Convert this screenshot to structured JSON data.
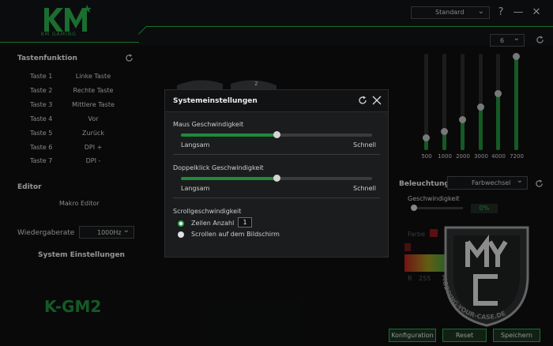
{
  "header": {
    "logo_text": "KM GAMING",
    "profile": "Standard",
    "help_symbol": "?",
    "minimize_symbol": "—",
    "close_symbol": "✕",
    "dropdown_arrow": "⌄"
  },
  "left": {
    "tastenfunktion_title": "Tastenfunktion",
    "keys": [
      {
        "label": "Taste 1",
        "func": "Linke Taste"
      },
      {
        "label": "Taste 2",
        "func": "Rechte Taste"
      },
      {
        "label": "Taste 3",
        "func": "Mittlere Taste"
      },
      {
        "label": "Taste 4",
        "func": "Vor"
      },
      {
        "label": "Taste 5",
        "func": "Zurück"
      },
      {
        "label": "Taste 6",
        "func": "DPI +"
      },
      {
        "label": "Taste 7",
        "func": "DPI -"
      }
    ],
    "editor_title": "Editor",
    "makro_editor": "Makro Editor",
    "wiedergaberate_label": "Wiedergaberate",
    "wiedergaberate_value": "1000Hz",
    "system_einstellungen": "System Einstellungen",
    "model_name": "K-GM2"
  },
  "mouse_badge": "2",
  "dpi": {
    "profile_value": "6",
    "levels": [
      {
        "value": "500",
        "level": 0.12
      },
      {
        "value": "1000",
        "level": 0.19
      },
      {
        "value": "2000",
        "level": 0.31
      },
      {
        "value": "3000",
        "level": 0.44
      },
      {
        "value": "4000",
        "level": 0.58
      },
      {
        "value": "7200",
        "level": 0.97
      }
    ]
  },
  "lighting": {
    "title": "Beleuchtung",
    "mode": "Farbwechsel",
    "speed_label": "Geschwindigkeit",
    "speed_value": "0%",
    "speed_level": 0.0,
    "color_label": "Farbe",
    "r_label": "R",
    "r_value": "255"
  },
  "buttons": {
    "konfiguration": "Konfiguration",
    "reset": "Reset",
    "speichern": "Speichern"
  },
  "dialog": {
    "title": "Systemeinstellungen",
    "maus_title": "Maus Geschwindigkeit",
    "maus_level": 0.5,
    "maus_min": "Langsam",
    "maus_max": "Schnell",
    "doppel_title": "Doppelklick Geschwindigkeit",
    "doppel_level": 0.5,
    "doppel_min": "Langsam",
    "doppel_max": "Schnell",
    "scroll_title": "Scrollgeschwindigkeit",
    "zeilen_label": "Zeilen Anzahl",
    "zeilen_value": "1",
    "bildschirm_label": "Scrollen auf dem Bildschirm"
  },
  "watermark_text": "MODDING-YOUR-CASE.DE",
  "colors": {
    "accent": "#2aa84a",
    "accent_dark": "#1f8a3a",
    "background": "#0e0f10"
  }
}
